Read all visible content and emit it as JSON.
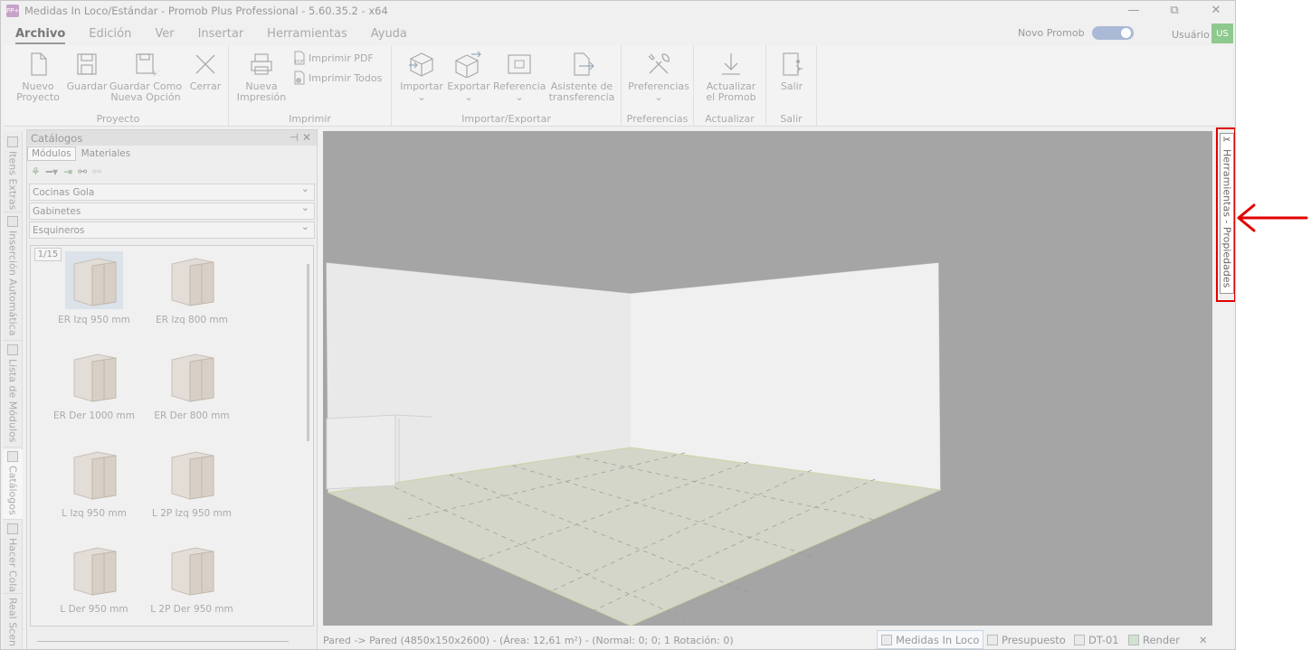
{
  "window": {
    "title": "Medidas In Loco/Estándar - Promob Plus Professional - 5.60.35.2 - x64",
    "logo_text": "PP+",
    "min_glyph": "—",
    "max_glyph": "⧉",
    "close_glyph": "✕"
  },
  "menu": [
    "Archivo",
    "Edición",
    "Ver",
    "Insertar",
    "Herramientas",
    "Ayuda"
  ],
  "header_right": {
    "novo_promob": "Novo Promob",
    "novo_promob_enabled": true,
    "user_label": "Usuário",
    "user_initials": "US"
  },
  "ribbon": {
    "groups": [
      {
        "label": "Proyecto",
        "buttons": [
          "Nuevo\nProyecto",
          "Guardar",
          "Guardar Como\nNueva Opción",
          "Cerrar"
        ]
      },
      {
        "label": "Imprimir",
        "buttons": [
          "Nueva\nImpresión"
        ],
        "small_buttons": [
          "Imprimir PDF",
          "Imprimir Todos"
        ]
      },
      {
        "label": "Importar/Exportar",
        "buttons": [
          "Importar",
          "Exportar",
          "Referencia",
          "Asistente de\ntransferencia"
        ]
      },
      {
        "label": "Preferencias",
        "buttons": [
          "Preferencias"
        ]
      },
      {
        "label": "Actualizar",
        "buttons": [
          "Actualizar\nel Promob"
        ]
      },
      {
        "label": "Salir",
        "buttons": [
          "Salir"
        ]
      }
    ]
  },
  "left_tabs": [
    "Itens Extras",
    "Inserción Automática",
    "Lista de Módulos",
    "Catálogos",
    "Hacer Cola",
    "Real Scen"
  ],
  "catalog": {
    "title": "Catálogos",
    "pin_glyph": "⊣",
    "close_glyph": "✕",
    "tabs": [
      "Módulos",
      "Materiales"
    ],
    "combos": [
      "Cocinas Gola",
      "Gabinetes",
      "Esquineros"
    ],
    "page_indicator": "1/15",
    "items": [
      {
        "label": "ER Izq 950 mm",
        "highlight": true
      },
      {
        "label": "ER Izq 800 mm"
      },
      {
        "label": "ER Der 1000 mm"
      },
      {
        "label": "ER Der 800 mm"
      },
      {
        "label": "L Izq 950 mm"
      },
      {
        "label": "L 2P Izq 950 mm"
      },
      {
        "label": "L Der 950 mm"
      },
      {
        "label": "L 2P Der 950 mm"
      }
    ]
  },
  "status": {
    "text": "Pared -> Pared (4850x150x2600) - (Área: 12,61 m²) - (Normal: 0; 0; 1 Rotación: 0)",
    "tabs": [
      "Medidas In Loco",
      "Presupuesto",
      "DT-01",
      "Render"
    ],
    "close_glyph": "✕"
  },
  "right_panel_tab": {
    "label": "Herramientas - Propiedades",
    "icon": "tools-icon",
    "highlight_color": "#e00000"
  },
  "colors": {
    "viewport_bg": "#a5a5a5",
    "annotation": "#e00000"
  }
}
